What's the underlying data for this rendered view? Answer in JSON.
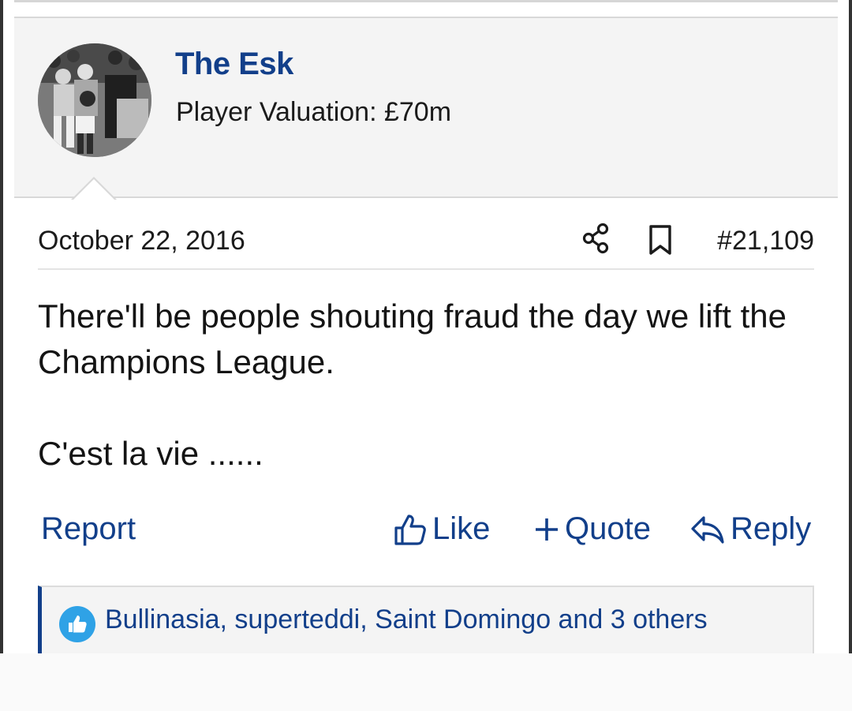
{
  "post": {
    "author": {
      "name": "The Esk",
      "title": "Player Valuation: £70m",
      "avatar_icon": "footballer-photo-avatar"
    },
    "date": "October 22, 2016",
    "post_number": "#21,109",
    "message": {
      "line1": "There'll be people shouting fraud the day we lift the Champions League.",
      "line2": "C'est la vie ......"
    },
    "actions": {
      "report": "Report",
      "like": "Like",
      "quote": "Quote",
      "reply": "Reply"
    },
    "reactions": {
      "icon": "thumbs-up-icon",
      "text": "Bullinasia, superteddi, Saint Domingo and 3 others"
    }
  },
  "colors": {
    "accent": "#123f8a",
    "header_bg": "#f4f4f4",
    "reaction_badge": "#2fa2e6",
    "text": "#141414"
  }
}
